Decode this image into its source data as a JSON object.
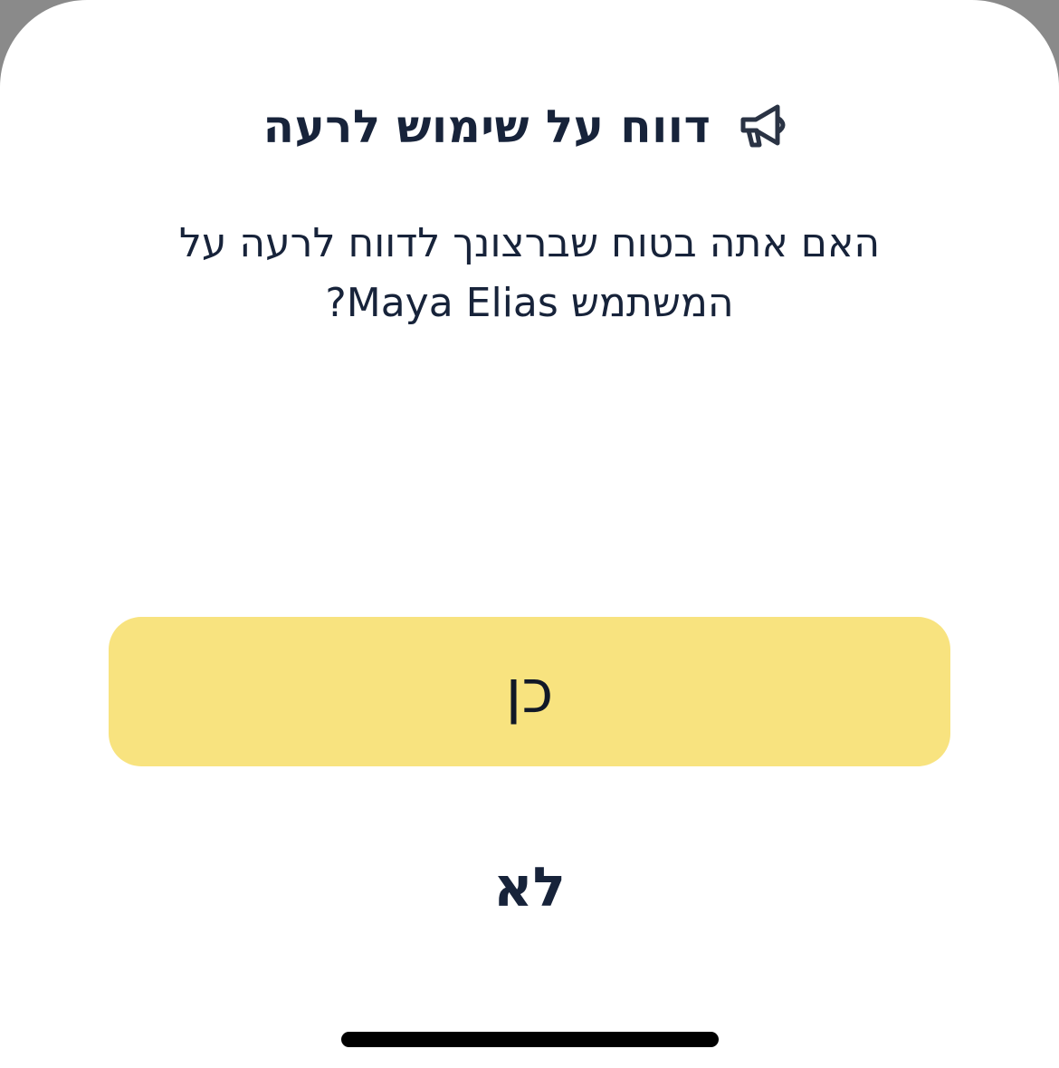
{
  "dialog": {
    "icon": "megaphone-icon",
    "title": "דווח על שימוש לרעה",
    "message_line1": "האם אתה בטוח שברצונך לדווח לרעה על",
    "message_line2": "המשתמש Maya Elias?",
    "confirm_label": "כן",
    "cancel_label": "לא"
  },
  "colors": {
    "accent": "#f8e37f",
    "text": "#17233a",
    "background": "#ffffff"
  }
}
